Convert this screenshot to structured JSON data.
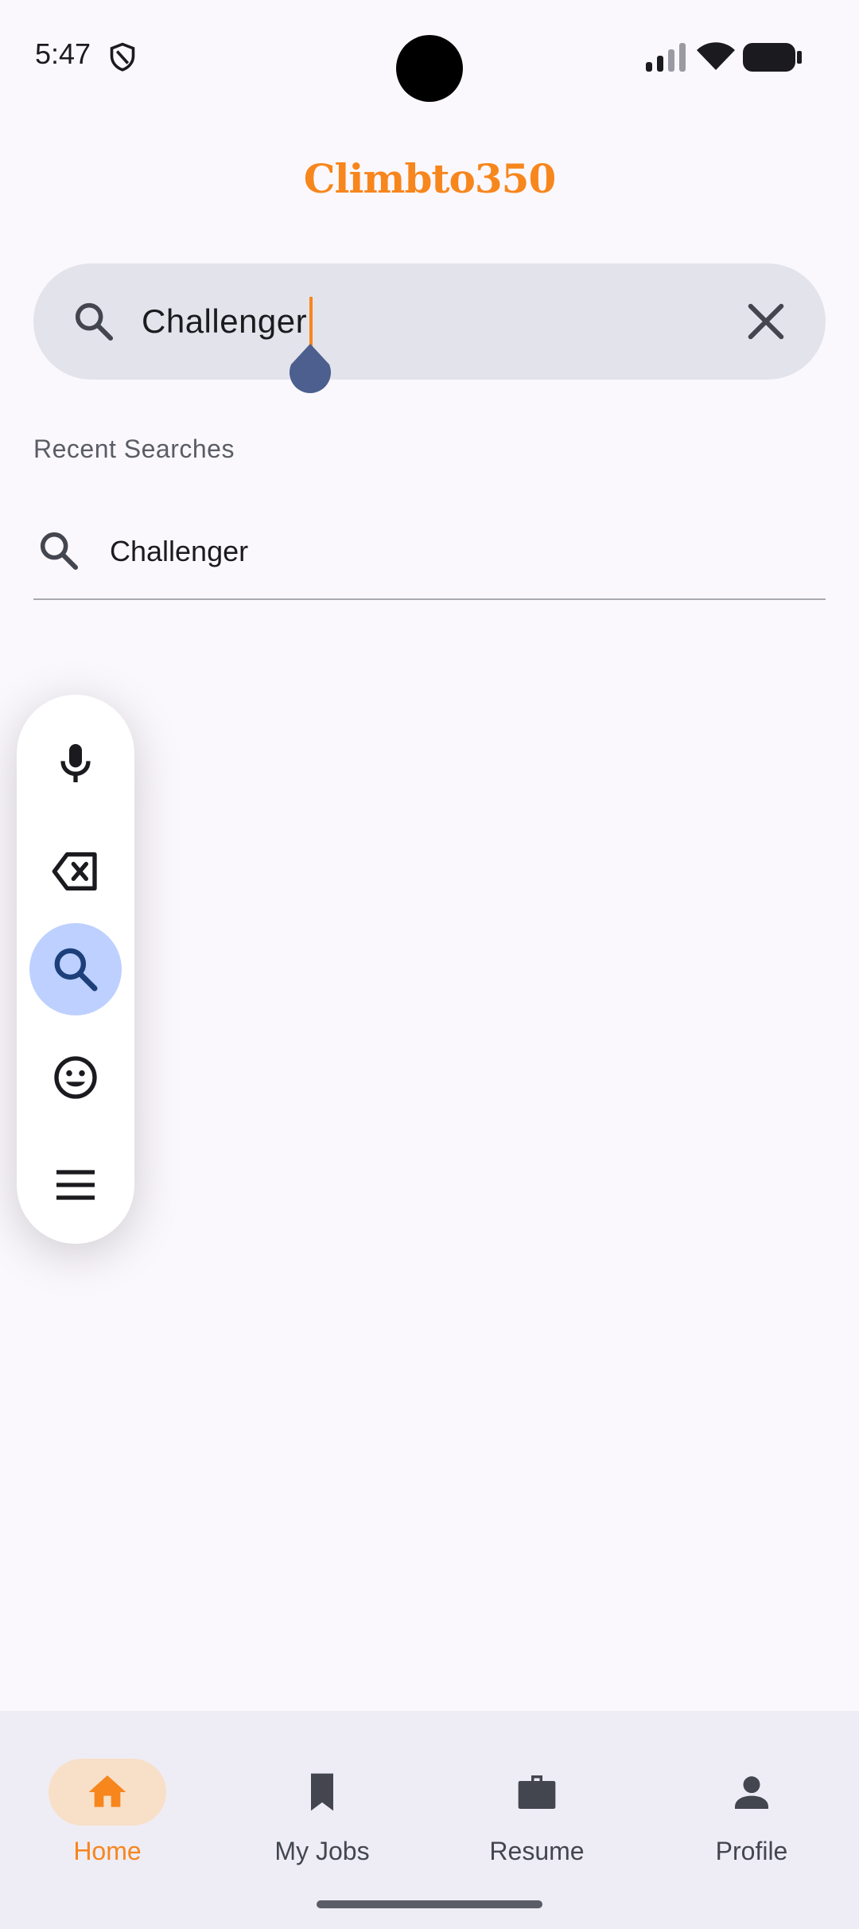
{
  "status_bar": {
    "time": "5:47",
    "icons": [
      "shield-icon",
      "signal-icon",
      "wifi-icon",
      "battery-icon"
    ]
  },
  "app": {
    "logo_text": "Climbto350",
    "brand_color": "#f7861d"
  },
  "search": {
    "value": "Challenger",
    "lead_icon": "search-icon",
    "clear_icon": "close-icon"
  },
  "recent": {
    "title": "Recent Searches",
    "items": [
      {
        "label": "Challenger",
        "icon": "search-icon"
      }
    ]
  },
  "keyboard_toolbar": {
    "buttons": [
      {
        "icon": "microphone-icon"
      },
      {
        "icon": "backspace-icon"
      },
      {
        "icon": "search-icon",
        "active": true
      },
      {
        "icon": "emoji-icon"
      },
      {
        "icon": "menu-icon"
      }
    ]
  },
  "bottom_nav": {
    "items": [
      {
        "label": "Home",
        "icon": "home-icon",
        "active": true
      },
      {
        "label": "My Jobs",
        "icon": "bookmark-icon",
        "active": false
      },
      {
        "label": "Resume",
        "icon": "briefcase-icon",
        "active": false
      },
      {
        "label": "Profile",
        "icon": "person-icon",
        "active": false
      }
    ]
  },
  "colors": {
    "accent": "#f7861d",
    "background": "#fbf8fd",
    "search_bar": "#e3e3eb",
    "nav_bar": "#eeedf5",
    "active_pill": "#f8dfc8",
    "toolbar_active": "#bdd0ff"
  }
}
